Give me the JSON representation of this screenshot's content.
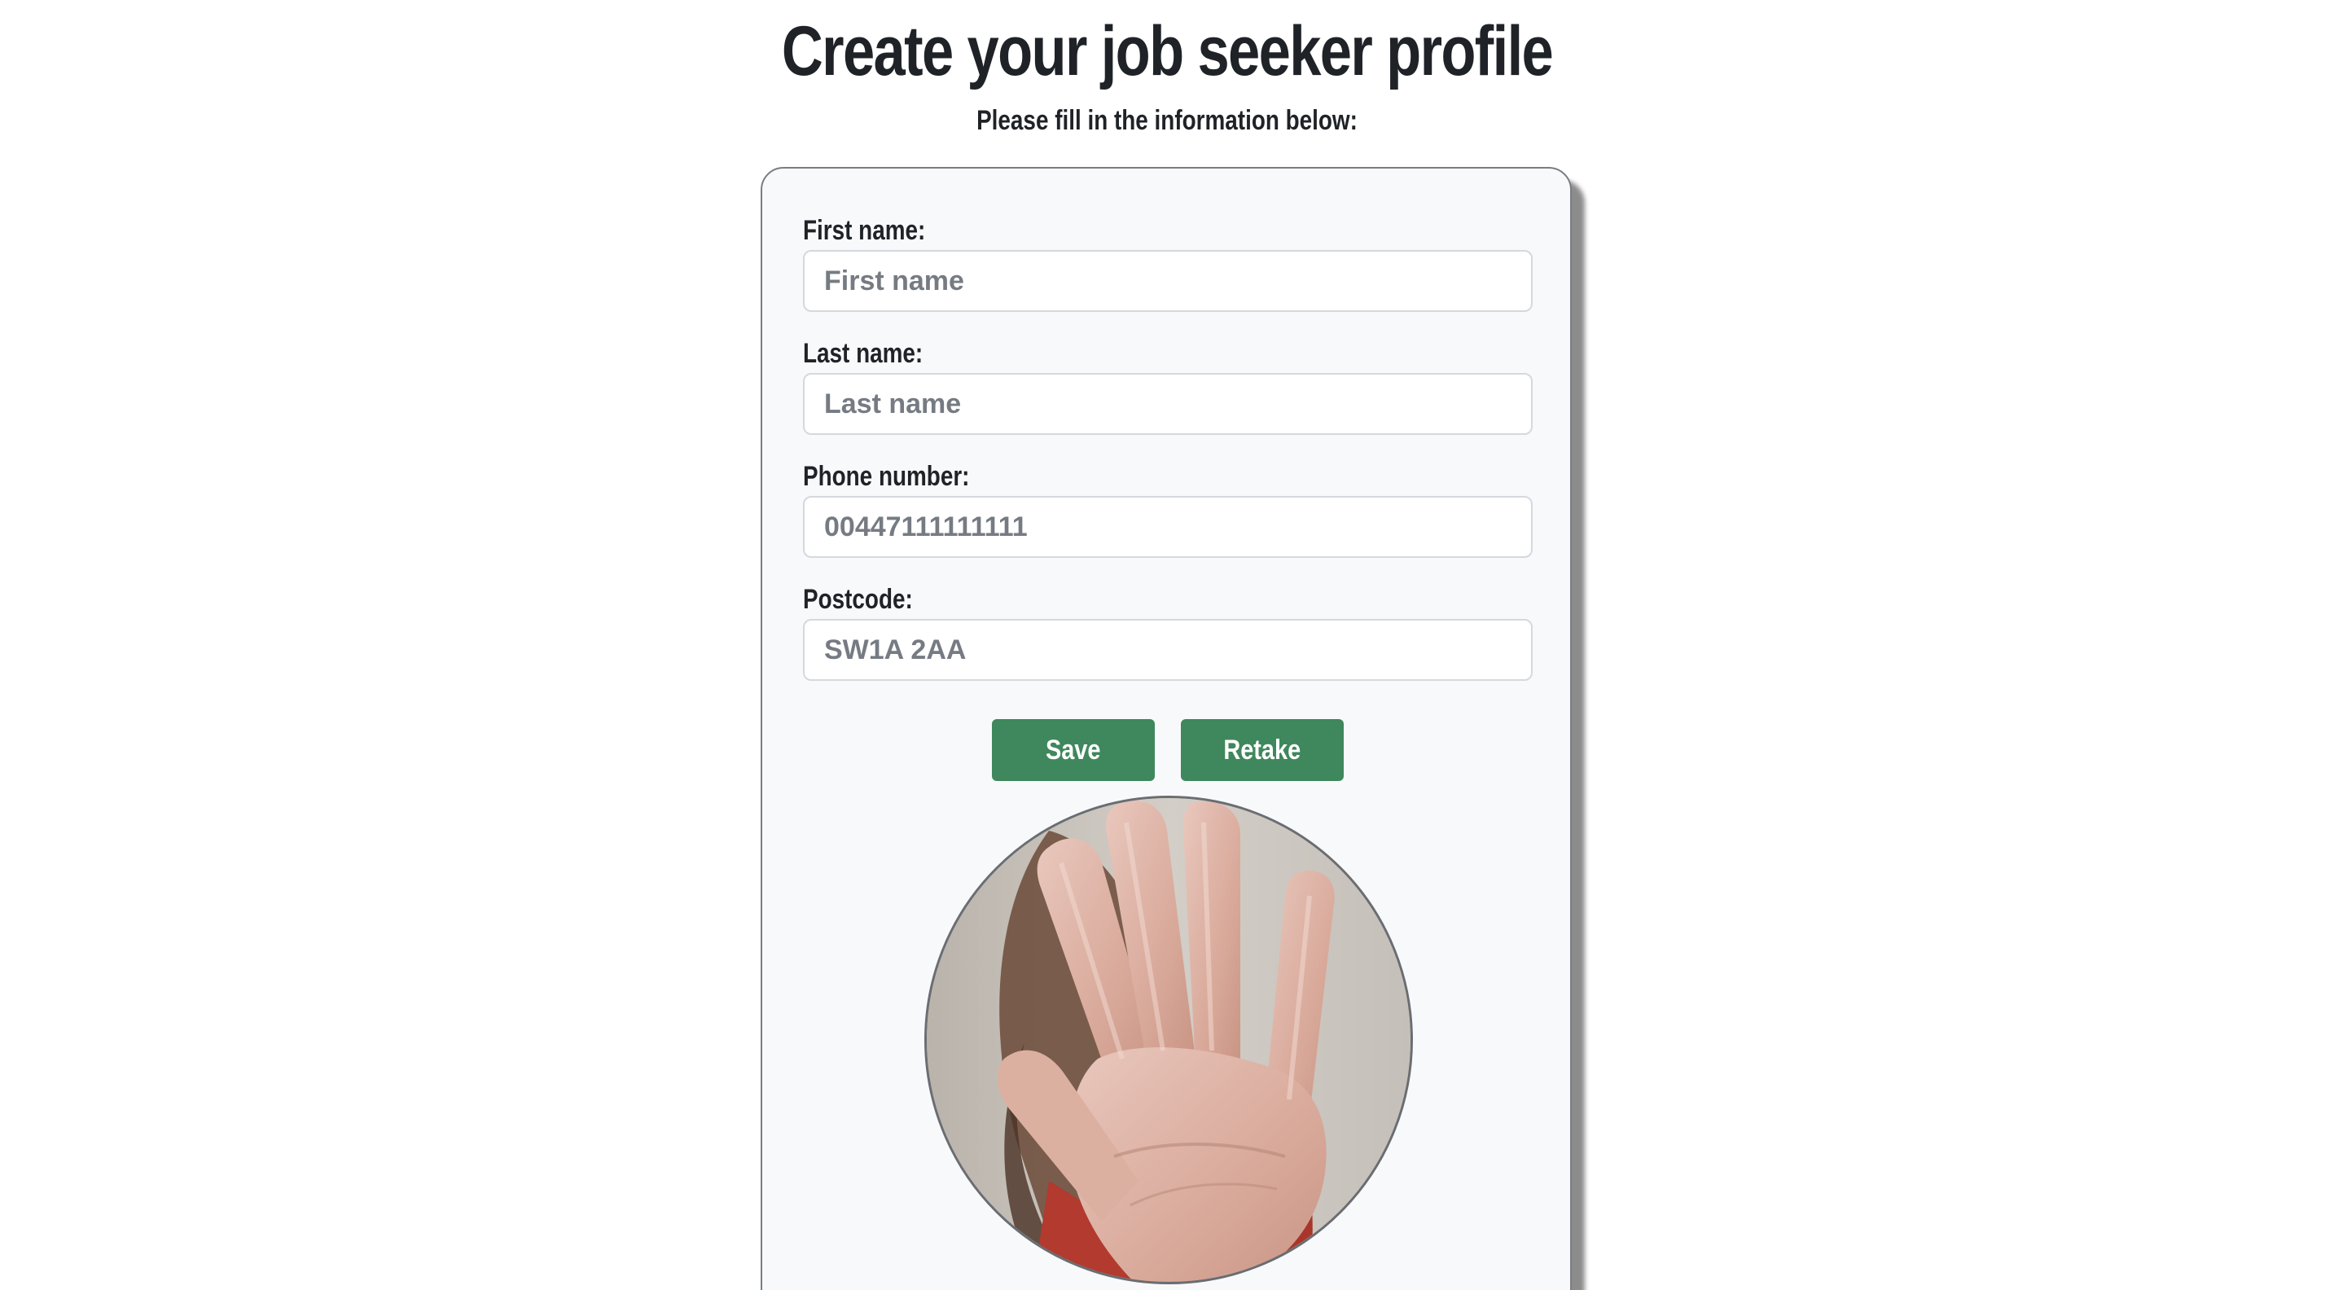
{
  "header": {
    "title": "Create your job seeker profile",
    "subtitle": "Please fill in the information below:"
  },
  "form": {
    "first_name": {
      "label": "First name:",
      "placeholder": "First name",
      "value": ""
    },
    "last_name": {
      "label": "Last name:",
      "placeholder": "Last name",
      "value": ""
    },
    "phone": {
      "label": "Phone number:",
      "placeholder": "00447111111111",
      "value": ""
    },
    "postcode": {
      "label": "Postcode:",
      "placeholder": "SW1A 2AA",
      "value": ""
    }
  },
  "actions": {
    "save_label": "Save",
    "retake_label": "Retake"
  },
  "colors": {
    "button": "#3f875c",
    "text": "#1f2328",
    "card_bg": "#f8f9fb"
  }
}
